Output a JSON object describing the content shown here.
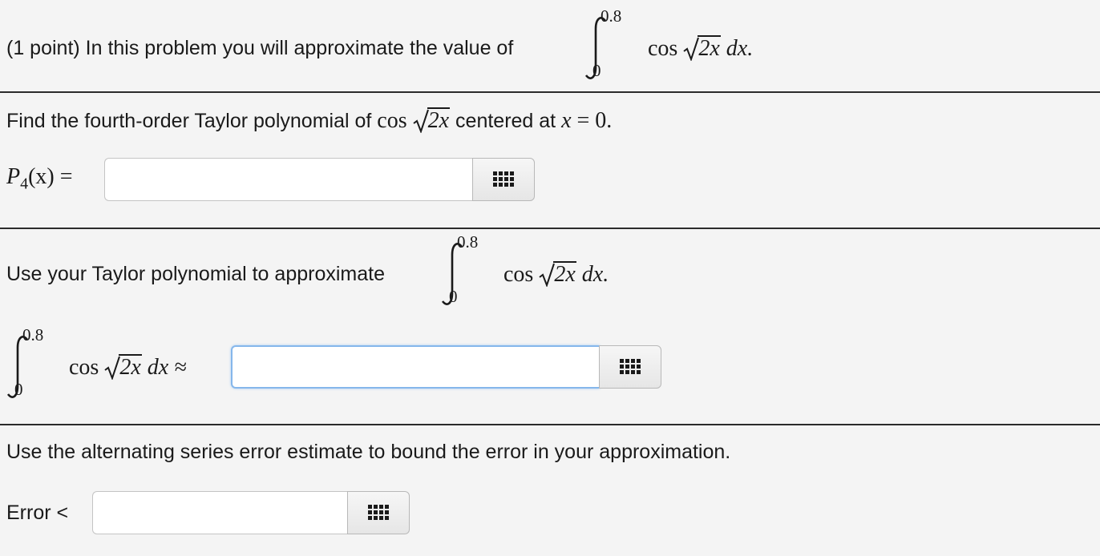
{
  "intro": {
    "prefix": "(1 point) In this problem you will approximate the value of",
    "integral_upper": "0.8",
    "integral_lower": "0",
    "integrand_fn": "cos",
    "radicand": "2x",
    "differential": "dx."
  },
  "part1": {
    "prefix": "Find the fourth-order Taylor polynomial of",
    "fn": "cos",
    "radicand": "2x",
    "middle": "centered at",
    "var": "x",
    "equals": "= 0.",
    "answer_label_P": "P",
    "answer_label_sub": "4",
    "answer_label_arg": "(x) =",
    "answer_value": "",
    "keypad_icon": "grid-icon"
  },
  "part2": {
    "prefix": "Use your Taylor polynomial to approximate",
    "integral_upper": "0.8",
    "integral_lower": "0",
    "fn": "cos",
    "radicand": "2x",
    "differential": "dx.",
    "answer_upper": "0.8",
    "answer_lower": "0",
    "answer_fn": "cos",
    "answer_radicand": "2x",
    "answer_differential": "dx ≈",
    "answer_value": "",
    "keypad_icon": "grid-icon"
  },
  "part3": {
    "prefix": "Use the alternating series error estimate to bound the error in your approximation.",
    "answer_label": "Error <",
    "answer_value": "",
    "keypad_icon": "grid-icon"
  }
}
